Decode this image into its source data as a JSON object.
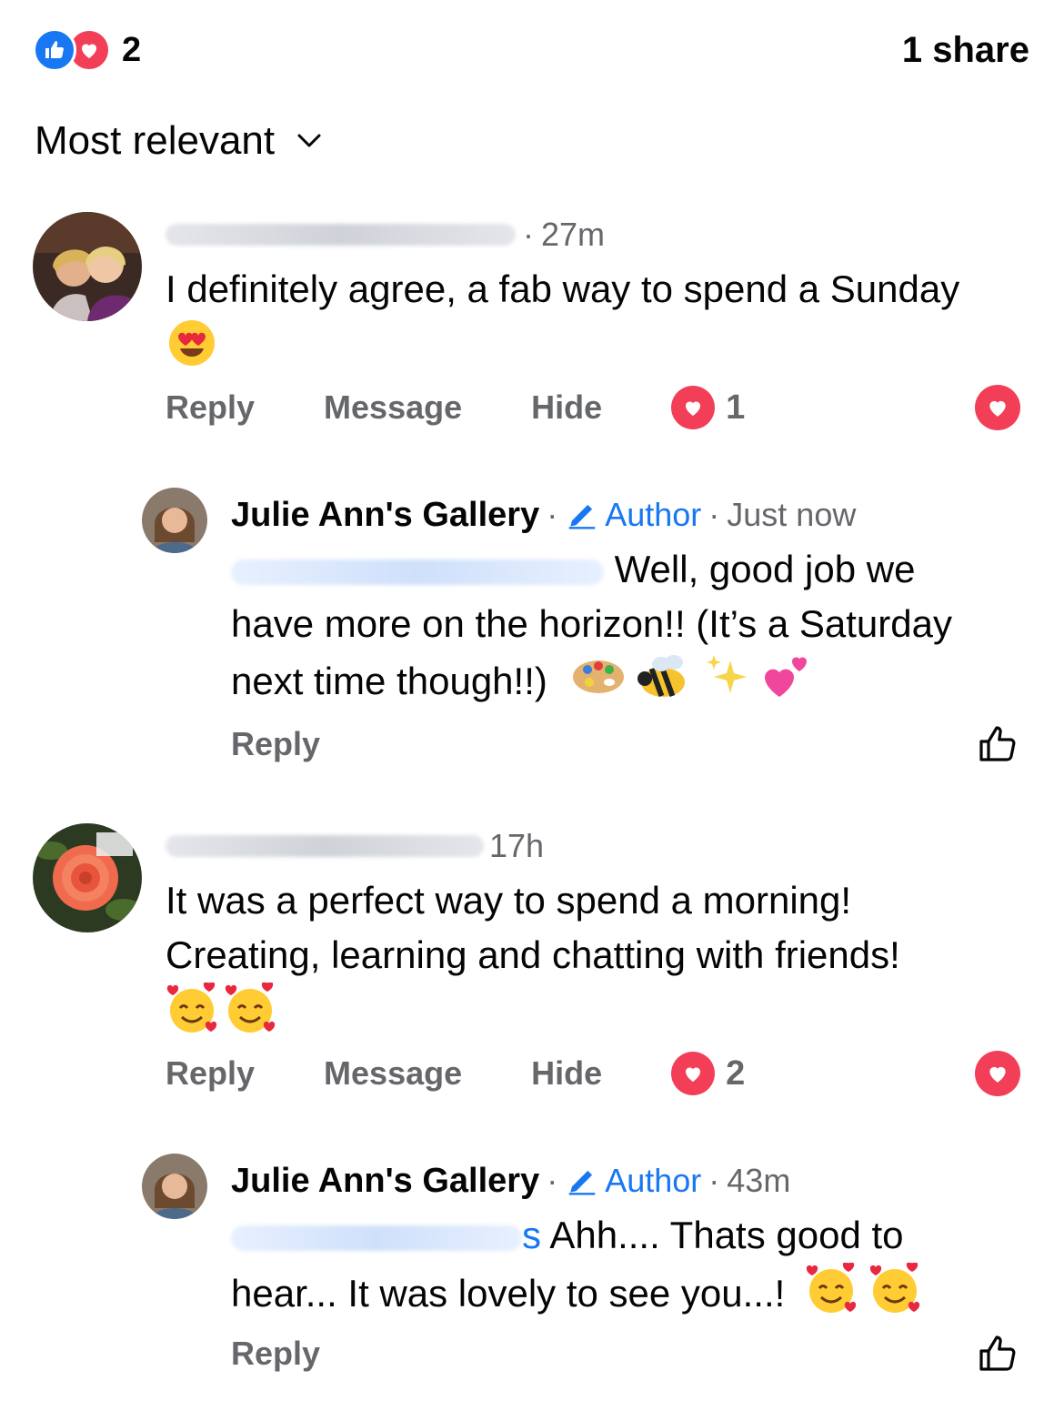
{
  "summary": {
    "reaction_count": "2",
    "share_label": "1 share"
  },
  "sort": {
    "label": "Most relevant"
  },
  "comments": [
    {
      "time": "27m",
      "text": "I definitely agree, a fab way to spend a Sunday",
      "actions": {
        "reply": "Reply",
        "message": "Message",
        "hide": "Hide"
      },
      "reaction_count": "1",
      "reply": {
        "name": "Julie Ann's Gallery",
        "badge": "Author",
        "time": "Just now",
        "text_line1": "Well, good job we",
        "text_line2": "have more on the horizon!! (It’s a Saturday",
        "text_line3": "next time though!!)",
        "reply_label": "Reply"
      }
    },
    {
      "time": "17h",
      "text_line1": "It was a perfect way to spend a morning!",
      "text_line2": "Creating, learning and chatting with friends!",
      "actions": {
        "reply": "Reply",
        "message": "Message",
        "hide": "Hide"
      },
      "reaction_count": "2",
      "reply": {
        "name": "Julie Ann's Gallery",
        "badge": "Author",
        "time": "43m",
        "mention_tail": "s",
        "text_line1": "Ahh.... Thats good to",
        "text_line2": "hear... It was lovely to see you...!",
        "reply_label": "Reply"
      }
    }
  ],
  "colors": {
    "accent": "#1877f2",
    "love": "#f33e58",
    "muted": "#65676b"
  }
}
